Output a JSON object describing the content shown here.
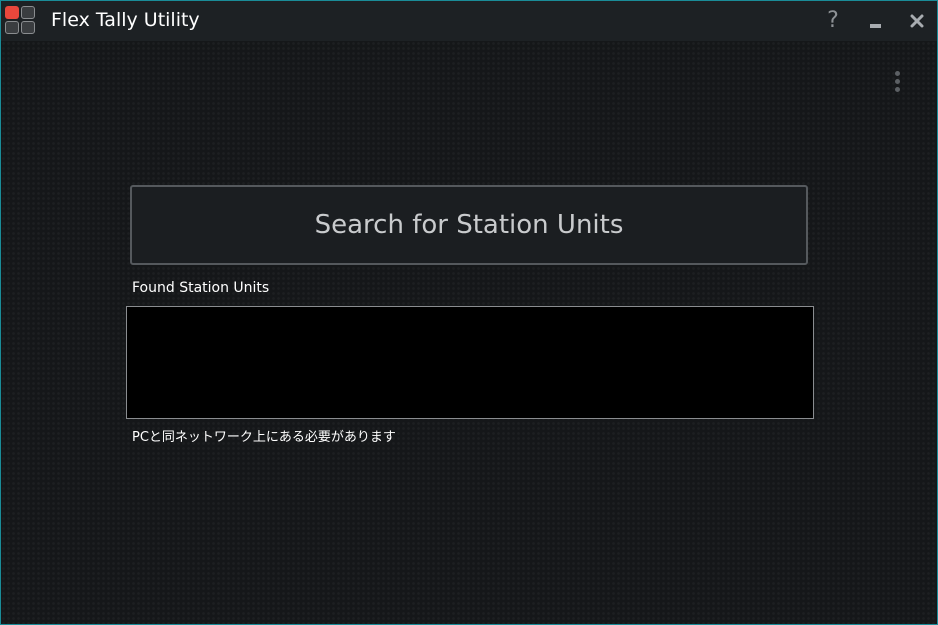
{
  "window": {
    "title": "Flex Tally Utility",
    "border_color": "#1a8c98",
    "logo_accent": "#e8473c"
  },
  "titlebar": {
    "help_label": "?",
    "icons": [
      "app-logo-icon",
      "question-icon",
      "minimize-icon",
      "close-icon"
    ]
  },
  "menu": {
    "icon": "more-vertical-icon"
  },
  "main": {
    "search_button_label": "Search for Station Units",
    "found_label": "Found Station Units",
    "found_units": [],
    "network_note": "PCと同ネットワーク上にある必要があります"
  }
}
